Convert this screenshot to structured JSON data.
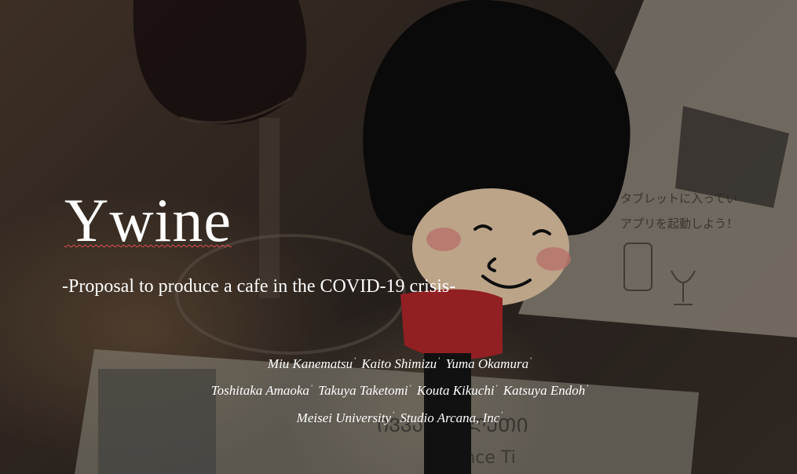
{
  "slide": {
    "title": "Ywine",
    "subtitle": "-Proposal to produce a cafe in the COVID-19 crisis-",
    "authors_line1": [
      "Miu Kanematsu",
      "Kaito Shimizu",
      "Yuma Okamura"
    ],
    "authors_line2": [
      "Toshitaka Amaoka",
      "Takuya Taketomi",
      "Kouta Kikuchi",
      "Katsuya Endoh"
    ],
    "affiliations": [
      "Meisei University",
      "Studio Arcana, Inc"
    ],
    "separator": "’"
  },
  "background": {
    "photo_text_card_jp": "タブレットに入ってい\nアプリを起動しよう！",
    "photo_text_ticket_georgian": "ᲘᲕᲕᲐᲡ ᲑᲘᲚᲔᲗᲘ",
    "photo_text_ticket_en": "n Dance Ti",
    "colors": {
      "text": "#ffffff",
      "spellcheck_underline": "#e05050",
      "wood": "#4b3a2d",
      "character_shirt": "#b3262a"
    }
  }
}
